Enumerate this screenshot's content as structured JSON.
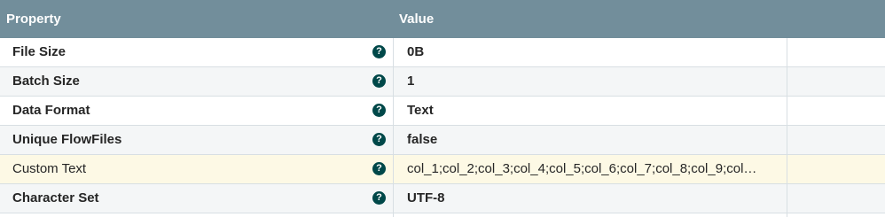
{
  "table": {
    "headers": {
      "property": "Property",
      "value": "Value"
    },
    "help_glyph": "?",
    "rows": [
      {
        "property": "File Size",
        "value": "0B",
        "help_icon": "question-circle-icon"
      },
      {
        "property": "Batch Size",
        "value": "1",
        "help_icon": "question-circle-icon"
      },
      {
        "property": "Data Format",
        "value": "Text",
        "help_icon": "question-circle-icon"
      },
      {
        "property": "Unique FlowFiles",
        "value": "false",
        "help_icon": "question-circle-icon"
      },
      {
        "property": "Custom Text",
        "value": "col_1;col_2;col_3;col_4;col_5;col_6;col_7;col_8;col_9;col…",
        "help_icon": "question-circle-icon",
        "selected": true
      },
      {
        "property": "Character Set",
        "value": "UTF-8",
        "help_icon": "question-circle-icon"
      }
    ],
    "colors": {
      "header_bg": "#728e9b",
      "selected_row_bg": "#fdf9e5",
      "help_icon_bg": "#004849"
    }
  }
}
